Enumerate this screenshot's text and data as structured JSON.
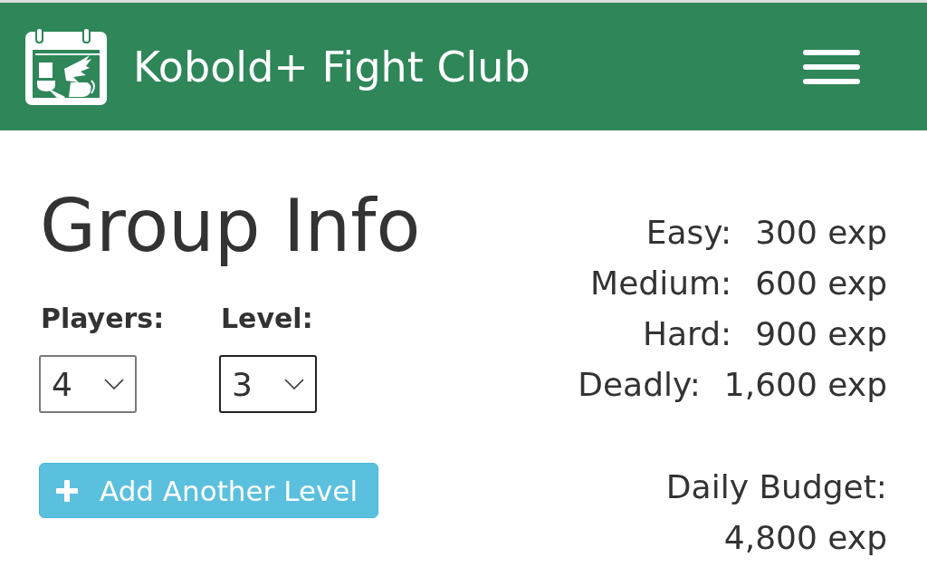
{
  "header": {
    "title": "Kobold+ Fight Club"
  },
  "group_info": {
    "heading": "Group Info",
    "selects": [
      {
        "label": "Players:",
        "value": "4",
        "focused": false
      },
      {
        "label": "Level:",
        "value": "3",
        "focused": true
      }
    ],
    "add_button": {
      "label": "Add Another Level"
    }
  },
  "thresholds": [
    {
      "label": "Easy:",
      "value": "300 exp"
    },
    {
      "label": "Medium:",
      "value": "600 exp"
    },
    {
      "label": "Hard:",
      "value": "900 exp"
    },
    {
      "label": "Deadly:",
      "value": "1,600 exp"
    }
  ],
  "daily_budget": {
    "label": "Daily Budget:",
    "value": "4,800 exp"
  }
}
